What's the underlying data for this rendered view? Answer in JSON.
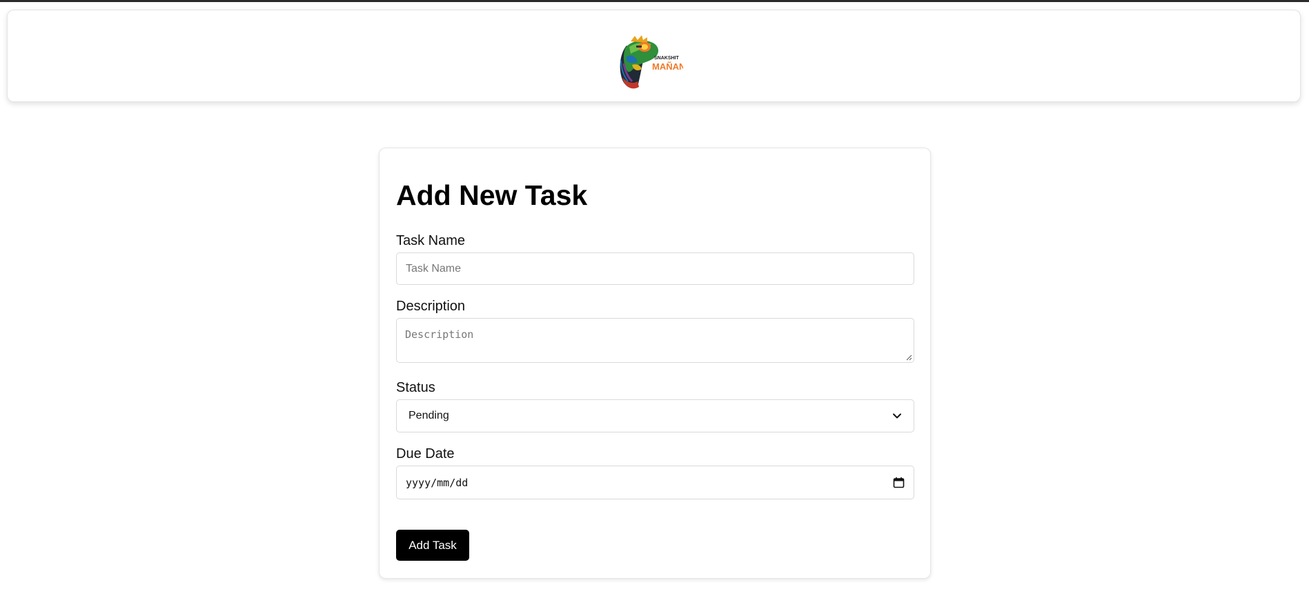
{
  "header": {
    "logo_icon": "chameleon-mascot-logo",
    "logo_small_text": "SNAKSHIT",
    "logo_big_text": "MAÑANA",
    "logo_accent": "#f07a2a"
  },
  "form": {
    "title": "Add New Task",
    "task_name": {
      "label": "Task Name",
      "placeholder": "Task Name",
      "value": ""
    },
    "description": {
      "label": "Description",
      "placeholder": "Description",
      "value": ""
    },
    "status": {
      "label": "Status",
      "selected": "Pending",
      "icon": "chevron-down-icon"
    },
    "due_date": {
      "label": "Due Date",
      "placeholder": "yyyy/mm/dd",
      "icon": "calendar-icon"
    },
    "submit_label": "Add Task",
    "button_color": "#000000"
  }
}
